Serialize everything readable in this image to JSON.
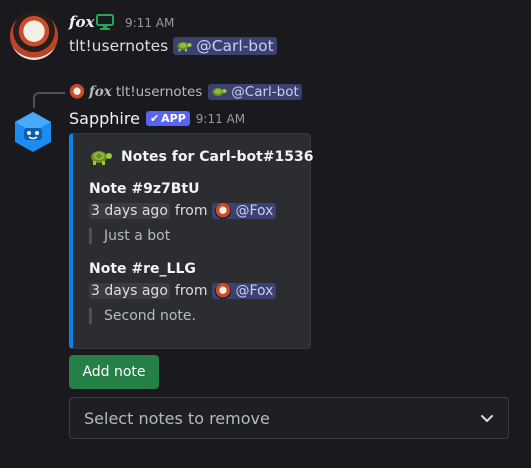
{
  "message1": {
    "author": "fox",
    "time": "9:11 AM",
    "command": "tlt!usernotes",
    "mention": "@Carl-bot"
  },
  "reply": {
    "author": "fox",
    "command": "tlt!usernotes",
    "mention": "@Carl-bot"
  },
  "message2": {
    "author": "Sapphire",
    "badge": "APP",
    "time": "9:11 AM"
  },
  "embed": {
    "color": "#0d83e6",
    "title": "Notes for Carl-bot#1536",
    "notes": [
      {
        "title": "Note #9z7BtU",
        "timestamp": "3 days ago",
        "from_word": "from",
        "author": "@Fox",
        "text": "Just a bot"
      },
      {
        "title": "Note #re_LLG",
        "timestamp": "3 days ago",
        "from_word": "from",
        "author": "@Fox",
        "text": "Second note."
      }
    ]
  },
  "actions": {
    "add_note_label": "Add note",
    "select_placeholder": "Select notes to remove"
  },
  "icons": {
    "monitor": "monitor-icon",
    "turtle": "turtle-icon",
    "chevron": "chevron-down-icon"
  }
}
